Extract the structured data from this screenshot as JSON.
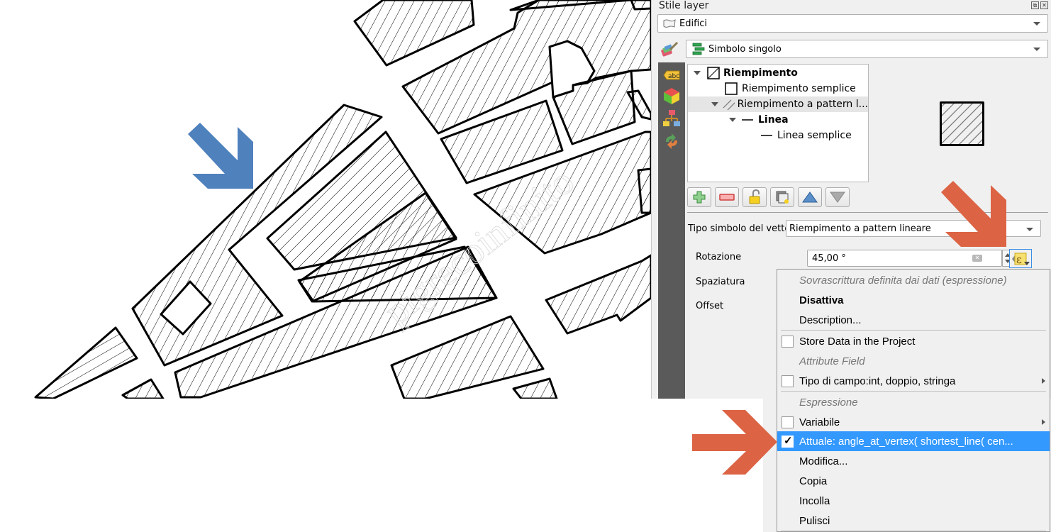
{
  "panel": {
    "title": "Stile layer",
    "layer_combo": {
      "value": "Edifici",
      "icon": "polygon-layer-icon"
    },
    "renderer_combo": {
      "value": "Simbolo singolo",
      "icon": "single-symbol-icon"
    },
    "sidebar_icons": [
      "symbology-paintbrush-icon",
      "labels-abc-icon",
      "3d-view-cube-icon",
      "diagrams-icon",
      "history-undo-redo-icon"
    ],
    "symbol_tree": [
      {
        "label": "Riempimento",
        "bold": true,
        "expanded": true,
        "icon": "fill-symbol-icon"
      },
      {
        "label": "Riempimento semplice",
        "bold": false,
        "icon": "simple-fill-icon"
      },
      {
        "label": "Riempimento a pattern l...",
        "bold": false,
        "expanded": true,
        "selected": true,
        "icon": "line-pattern-fill-icon"
      },
      {
        "label": "Linea",
        "bold": true,
        "expanded": true,
        "icon": "line-symbol-icon"
      },
      {
        "label": "Linea semplice",
        "bold": false,
        "icon": "simple-line-icon"
      }
    ],
    "tool_buttons": [
      "add-symbol-layer",
      "remove-symbol-layer",
      "lock-color",
      "duplicate-symbol-layer",
      "move-up",
      "move-down"
    ],
    "vector_type": {
      "label": "Tipo simbolo del vettore",
      "value": "Riempimento a pattern lineare"
    },
    "rotation": {
      "label": "Rotazione",
      "value": "45,00 °"
    },
    "spacing": {
      "label": "Spaziatura"
    },
    "offset": {
      "label": "Offset"
    }
  },
  "context_menu": {
    "items": [
      {
        "type": "header",
        "label": "Sovrascrittura definita dai dati (espressione)"
      },
      {
        "type": "item",
        "label": "Disattiva",
        "bold": true
      },
      {
        "type": "item",
        "label": "Description..."
      },
      {
        "type": "separator"
      },
      {
        "type": "check",
        "label": "Store Data in the Project",
        "checked": false
      },
      {
        "type": "header",
        "label": "Attribute Field"
      },
      {
        "type": "check",
        "label": "Tipo di campo:int, doppio, stringa",
        "checked": false,
        "submenu": true
      },
      {
        "type": "separator"
      },
      {
        "type": "header",
        "label": "Espressione"
      },
      {
        "type": "check",
        "label": "Variabile",
        "checked": false,
        "submenu": true
      },
      {
        "type": "check",
        "label": "Attuale: angle_at_vertex( shortest_line( cen...",
        "checked": true,
        "highlighted": true
      },
      {
        "type": "item",
        "label": "Modifica..."
      },
      {
        "type": "item",
        "label": "Copia"
      },
      {
        "type": "item",
        "label": "Incolla"
      },
      {
        "type": "item",
        "label": "Pulisci"
      }
    ]
  },
  "colors": {
    "blue_arrow": "#4f81bd",
    "orange_arrow": "#dc6445",
    "menu_highlight": "#3399ff",
    "panel_bg": "#f0f0f0",
    "sidebar_bg": "#5a5a5a"
  },
  "map": {
    "layer": "Edifici",
    "fill_style": "line pattern hatching",
    "watermark": "pigrecoinfinito"
  }
}
